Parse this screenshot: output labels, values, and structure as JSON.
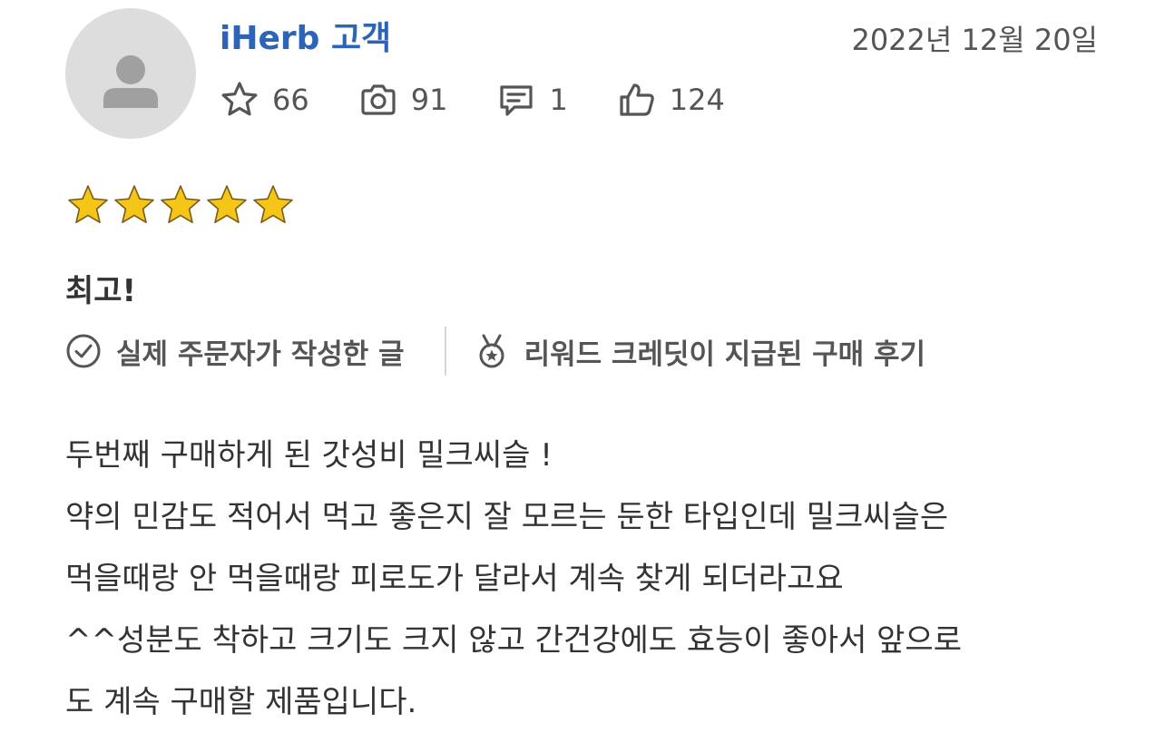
{
  "review": {
    "author": "iHerb 고객",
    "date": "2022년 12월 20일",
    "stats": {
      "rewards": "66",
      "photos": "91",
      "comments": "1",
      "likes": "124"
    },
    "rating": 5,
    "rating_max": 5,
    "title": "최고!",
    "badges": {
      "verified_purchase": "실제 주문자가 작성한 글",
      "rewarded_review": "리워드 크레딧이 지급된 구매 후기"
    },
    "body_lines": [
      "두번째 구매하게 된 갓성비 밀크씨슬 !",
      "약의 민감도 적어서 먹고 좋은지 잘 모르는 둔한 타입인데 밀크씨슬은",
      "먹을때랑 안 먹을때랑 피로도가 달라서 계속 찾게 되더라고요",
      "^^성분도 착하고 크기도 크지 않고 간건강에도 효능이 좋아서 앞으로",
      "도 계속 구매할 제품입니다."
    ]
  },
  "icons": {
    "avatar": "person-icon",
    "rewards": "star-outline-icon",
    "photos": "camera-icon",
    "comments": "comment-icon",
    "likes": "thumbs-up-icon",
    "verified_purchase": "check-circle-icon",
    "rewarded_review": "medal-icon"
  },
  "colors": {
    "author_link": "#2d64b8",
    "star_fill": "#f5c518",
    "avatar_bg": "#dddddd"
  }
}
